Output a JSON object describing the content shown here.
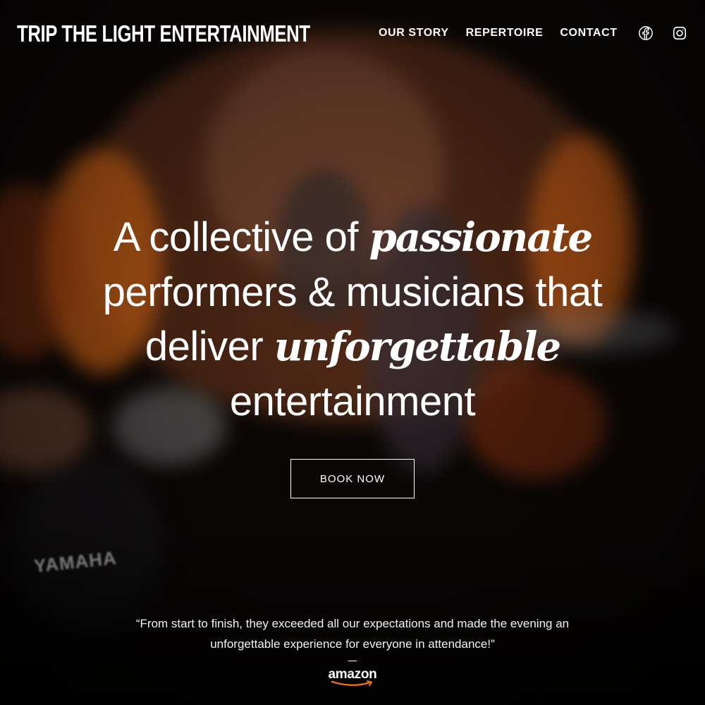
{
  "header": {
    "logo": "TRIP THE LIGHT ENTERTAINMENT",
    "nav": [
      "OUR STORY",
      "REPERTOIRE",
      "CONTACT"
    ],
    "social_icons": [
      "facebook-icon",
      "instagram-icon"
    ]
  },
  "hero": {
    "line1_a": "A collective of ",
    "line1_em": "passionate",
    "line2": "performers & musicians that",
    "line3_a": "deliver ",
    "line3_em": "unforgettable",
    "line4": "entertainment",
    "cta": "BOOK NOW"
  },
  "background": {
    "drum_brand": "YAMAHA"
  },
  "testimonial": {
    "quote": "“From start to finish, they exceeded all our expectations and made the evening an unforgettable experience for everyone in attendance!”",
    "source": "amazon"
  },
  "colors": {
    "text": "#ffffff",
    "stage_orange": "#e8731c",
    "background": "#0d0907"
  }
}
